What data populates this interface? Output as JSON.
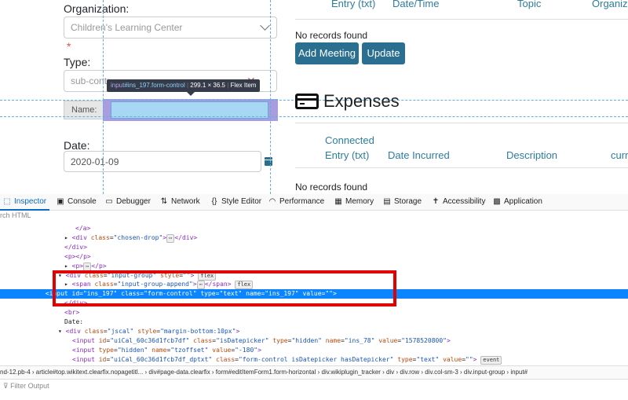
{
  "form": {
    "organization_label": "Organization:",
    "organization_value": "Children's Learning Center",
    "required_mark": "*",
    "type_label": "Type:",
    "type_value": "sub-contr",
    "name_label": "Name:",
    "name_value": "",
    "date_label": "Date:",
    "date_value": "2020-01-09"
  },
  "tooltip": {
    "selector_tag": "input",
    "selector_rest": "#ins_197.form-control",
    "size": "299.1 × 36.5",
    "kind": "Flex Item"
  },
  "meetings": {
    "headers": [
      "Entry (txt)",
      "Date/Time",
      "Topic",
      "Organiza"
    ],
    "empty_text": "No records found",
    "add_button": "Add Meeting",
    "update_button": "Update"
  },
  "expenses": {
    "title": "Expenses",
    "headers": [
      "Connected",
      "Entry (txt)",
      "Date Incurred",
      "Description",
      "curr"
    ],
    "empty_text": "No records found"
  },
  "devtools": {
    "tabs": [
      {
        "label": "Inspector",
        "icon": "inspector-icon"
      },
      {
        "label": "Console",
        "icon": "console-icon"
      },
      {
        "label": "Debugger",
        "icon": "debugger-icon"
      },
      {
        "label": "Network",
        "icon": "network-icon"
      },
      {
        "label": "Style Editor",
        "icon": "style-editor-icon"
      },
      {
        "label": "Performance",
        "icon": "performance-icon"
      },
      {
        "label": "Memory",
        "icon": "memory-icon"
      },
      {
        "label": "Storage",
        "icon": "storage-icon"
      },
      {
        "label": "Accessibility",
        "icon": "accessibility-icon"
      },
      {
        "label": "Application",
        "icon": "application-icon"
      }
    ],
    "search_placeholder": "rch HTML",
    "breadcrumbs": "nd-12.pb-4 › article#top.wikitext.clearfix.nopagetitl... › div#page-data.clearfix › form#editItemForm1.form-horizontal › div.wikiplugin_tracker › div › div.row › div.col-sm-3 › div.input-group › input#",
    "filter_placeholder": "Filter Output",
    "badge_flex": "flex",
    "badge_event": "event"
  },
  "colors": {
    "highlight_border": "#e00000",
    "accent": "#2a6f8f",
    "selection": "#0a84ff"
  }
}
